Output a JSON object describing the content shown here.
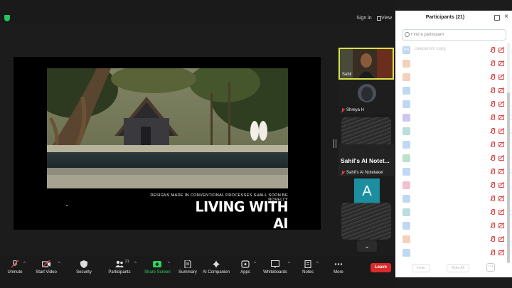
{
  "topbar": {
    "signin_label": "Sign in",
    "view_label": "View"
  },
  "slide": {
    "caption": "DESIGNS MADE IN CONVENTIONAL PROCESSES SHALL SOON BE NOVELTY",
    "title": "LIVING WITH AI"
  },
  "video_tiles": [
    {
      "name": "Sahil",
      "active": true
    },
    {
      "name": "Shreya H"
    },
    {
      "name": "Sahil's AI Notetaker",
      "display_text": "Sahil's AI Notet...",
      "avatar_letter": "A"
    }
  ],
  "panel": {
    "title": "Participants (21)",
    "search_placeholder": "Find a participant",
    "participants": [
      {
        "initials": "DG",
        "name": "Deepanshi Garg",
        "color": "#4a90d9"
      },
      {
        "initials": "",
        "name": "",
        "color": "#e07a3a"
      },
      {
        "initials": "",
        "name": "",
        "color": "#e07a3a"
      },
      {
        "initials": "",
        "name": "",
        "color": "#4a90d9"
      },
      {
        "initials": "",
        "name": "",
        "color": "#4a90d9"
      },
      {
        "initials": "",
        "name": "",
        "color": "#7a5cd9"
      },
      {
        "initials": "",
        "name": "",
        "color": "#3aa0a0"
      },
      {
        "initials": "",
        "name": "",
        "color": "#4a90d9"
      },
      {
        "initials": "",
        "name": "",
        "color": "#3ab06a"
      },
      {
        "initials": "",
        "name": "",
        "color": "#4a90d9"
      },
      {
        "initials": "",
        "name": "",
        "color": "#d94a7a"
      },
      {
        "initials": "",
        "name": "",
        "color": "#4a90d9"
      },
      {
        "initials": "",
        "name": "",
        "color": "#3aa0a0"
      },
      {
        "initials": "",
        "name": "",
        "color": "#4a90d9"
      },
      {
        "initials": "",
        "name": "",
        "color": "#e07a3a"
      },
      {
        "initials": "",
        "name": "",
        "color": "#4a90d9"
      }
    ],
    "footer": {
      "invite_label": "Invite",
      "mute_all_label": "Mute All",
      "more_label": "···"
    }
  },
  "toolbar": {
    "unmute": "Unmute",
    "start_video": "Start Video",
    "security": "Security",
    "participants": "Participants",
    "participants_count": "21",
    "share_screen": "Share Screen",
    "summary": "Summary",
    "ai_companion": "AI Companion",
    "apps": "Apps",
    "whiteboards": "Whiteboards",
    "notes": "Notes",
    "more": "More",
    "leave": "Leave"
  },
  "colors": {
    "accent_green": "#2fd15a",
    "leave_red": "#d92b2b",
    "active_speaker": "#d8e34a",
    "mute_red": "#e04545"
  }
}
